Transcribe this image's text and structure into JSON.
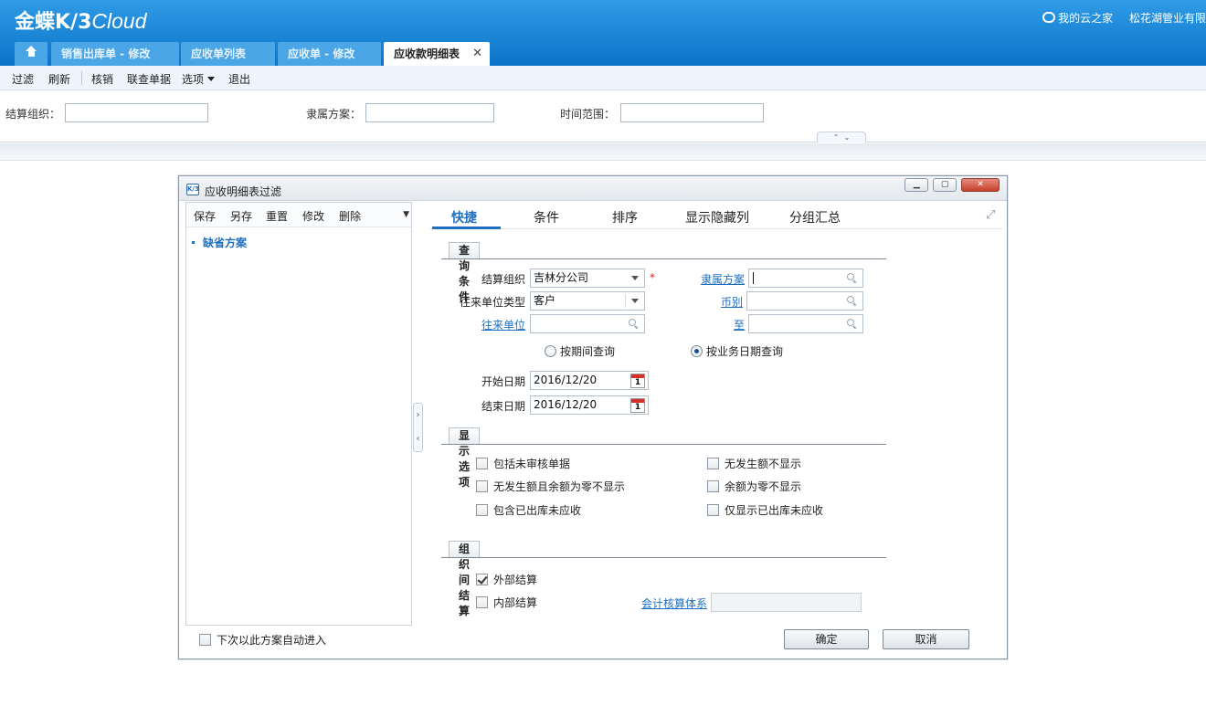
{
  "app": {
    "logo_main": "金蝶K/3",
    "logo_cloud": "Cloud",
    "my_cloud_home": "我的云之家",
    "company": "松花湖管业有限"
  },
  "tabs": [
    {
      "label": "销售出库单 - 修改"
    },
    {
      "label": "应收单列表"
    },
    {
      "label": "应收单 - 修改"
    },
    {
      "label": "应收款明细表",
      "active": true
    }
  ],
  "toolbar": {
    "filter": "过滤",
    "refresh": "刷新",
    "writeoff": "核销",
    "linked_query": "联查单据",
    "options": "选项",
    "exit": "退出"
  },
  "filter_strip": {
    "settle_org_label": "结算组织：",
    "scheme_label": "隶属方案：",
    "time_range_label": "时间范围：",
    "settle_org_value": "",
    "scheme_value": "",
    "time_range_value": ""
  },
  "dialog": {
    "title": "应收明细表过滤",
    "icon_text": "K/3",
    "left_toolbar": {
      "save": "保存",
      "save_as": "另存",
      "reset": "重置",
      "modify": "修改",
      "delete": "删除"
    },
    "schemes": [
      {
        "label": "缺省方案"
      }
    ],
    "auto_enter_label": "下次以此方案自动进入",
    "auto_enter_checked": false,
    "tabs": [
      "快捷",
      "条件",
      "排序",
      "显示隐藏列",
      "分组汇总"
    ],
    "active_tab": "快捷",
    "query_section": {
      "title": "查询条件",
      "settle_org_label": "结算组织",
      "settle_org_value": "吉林分公司",
      "required_mark": "*",
      "scheme_link": "隶属方案",
      "scheme_value": "",
      "partner_type_label": "往来单位类型",
      "partner_type_value": "客户",
      "currency_link": "币别",
      "currency_value": "",
      "partner_link": "往来单位",
      "partner_value": "",
      "to_link": "至",
      "to_value": "",
      "radio_period": "按期间查询",
      "radio_bizdate": "按业务日期查询",
      "selected_radio": "按业务日期查询",
      "start_date_label": "开始日期",
      "start_date_value": "2016/12/20",
      "end_date_label": "结束日期",
      "end_date_value": "2016/12/20",
      "calendar_day": "1"
    },
    "display_section": {
      "title": "显示选项",
      "options": [
        {
          "label": "包括未审核单据",
          "checked": false
        },
        {
          "label": "无发生额不显示",
          "checked": false
        },
        {
          "label": "无发生额且余额为零不显示",
          "checked": false
        },
        {
          "label": "余额为零不显示",
          "checked": false
        },
        {
          "label": "包含已出库未应收",
          "checked": false
        },
        {
          "label": "仅显示已出库未应收",
          "checked": false
        }
      ]
    },
    "org_section": {
      "title": "组织间结算",
      "external_label": "外部结算",
      "external_checked": true,
      "internal_label": "内部结算",
      "internal_checked": false,
      "accounting_system_link": "会计核算体系",
      "accounting_system_value": ""
    },
    "ok_button": "确定",
    "cancel_button": "取消"
  },
  "colors": {
    "header_blue": "#0b74c9",
    "link_blue": "#1e6fc2",
    "required_red": "#e02020"
  }
}
